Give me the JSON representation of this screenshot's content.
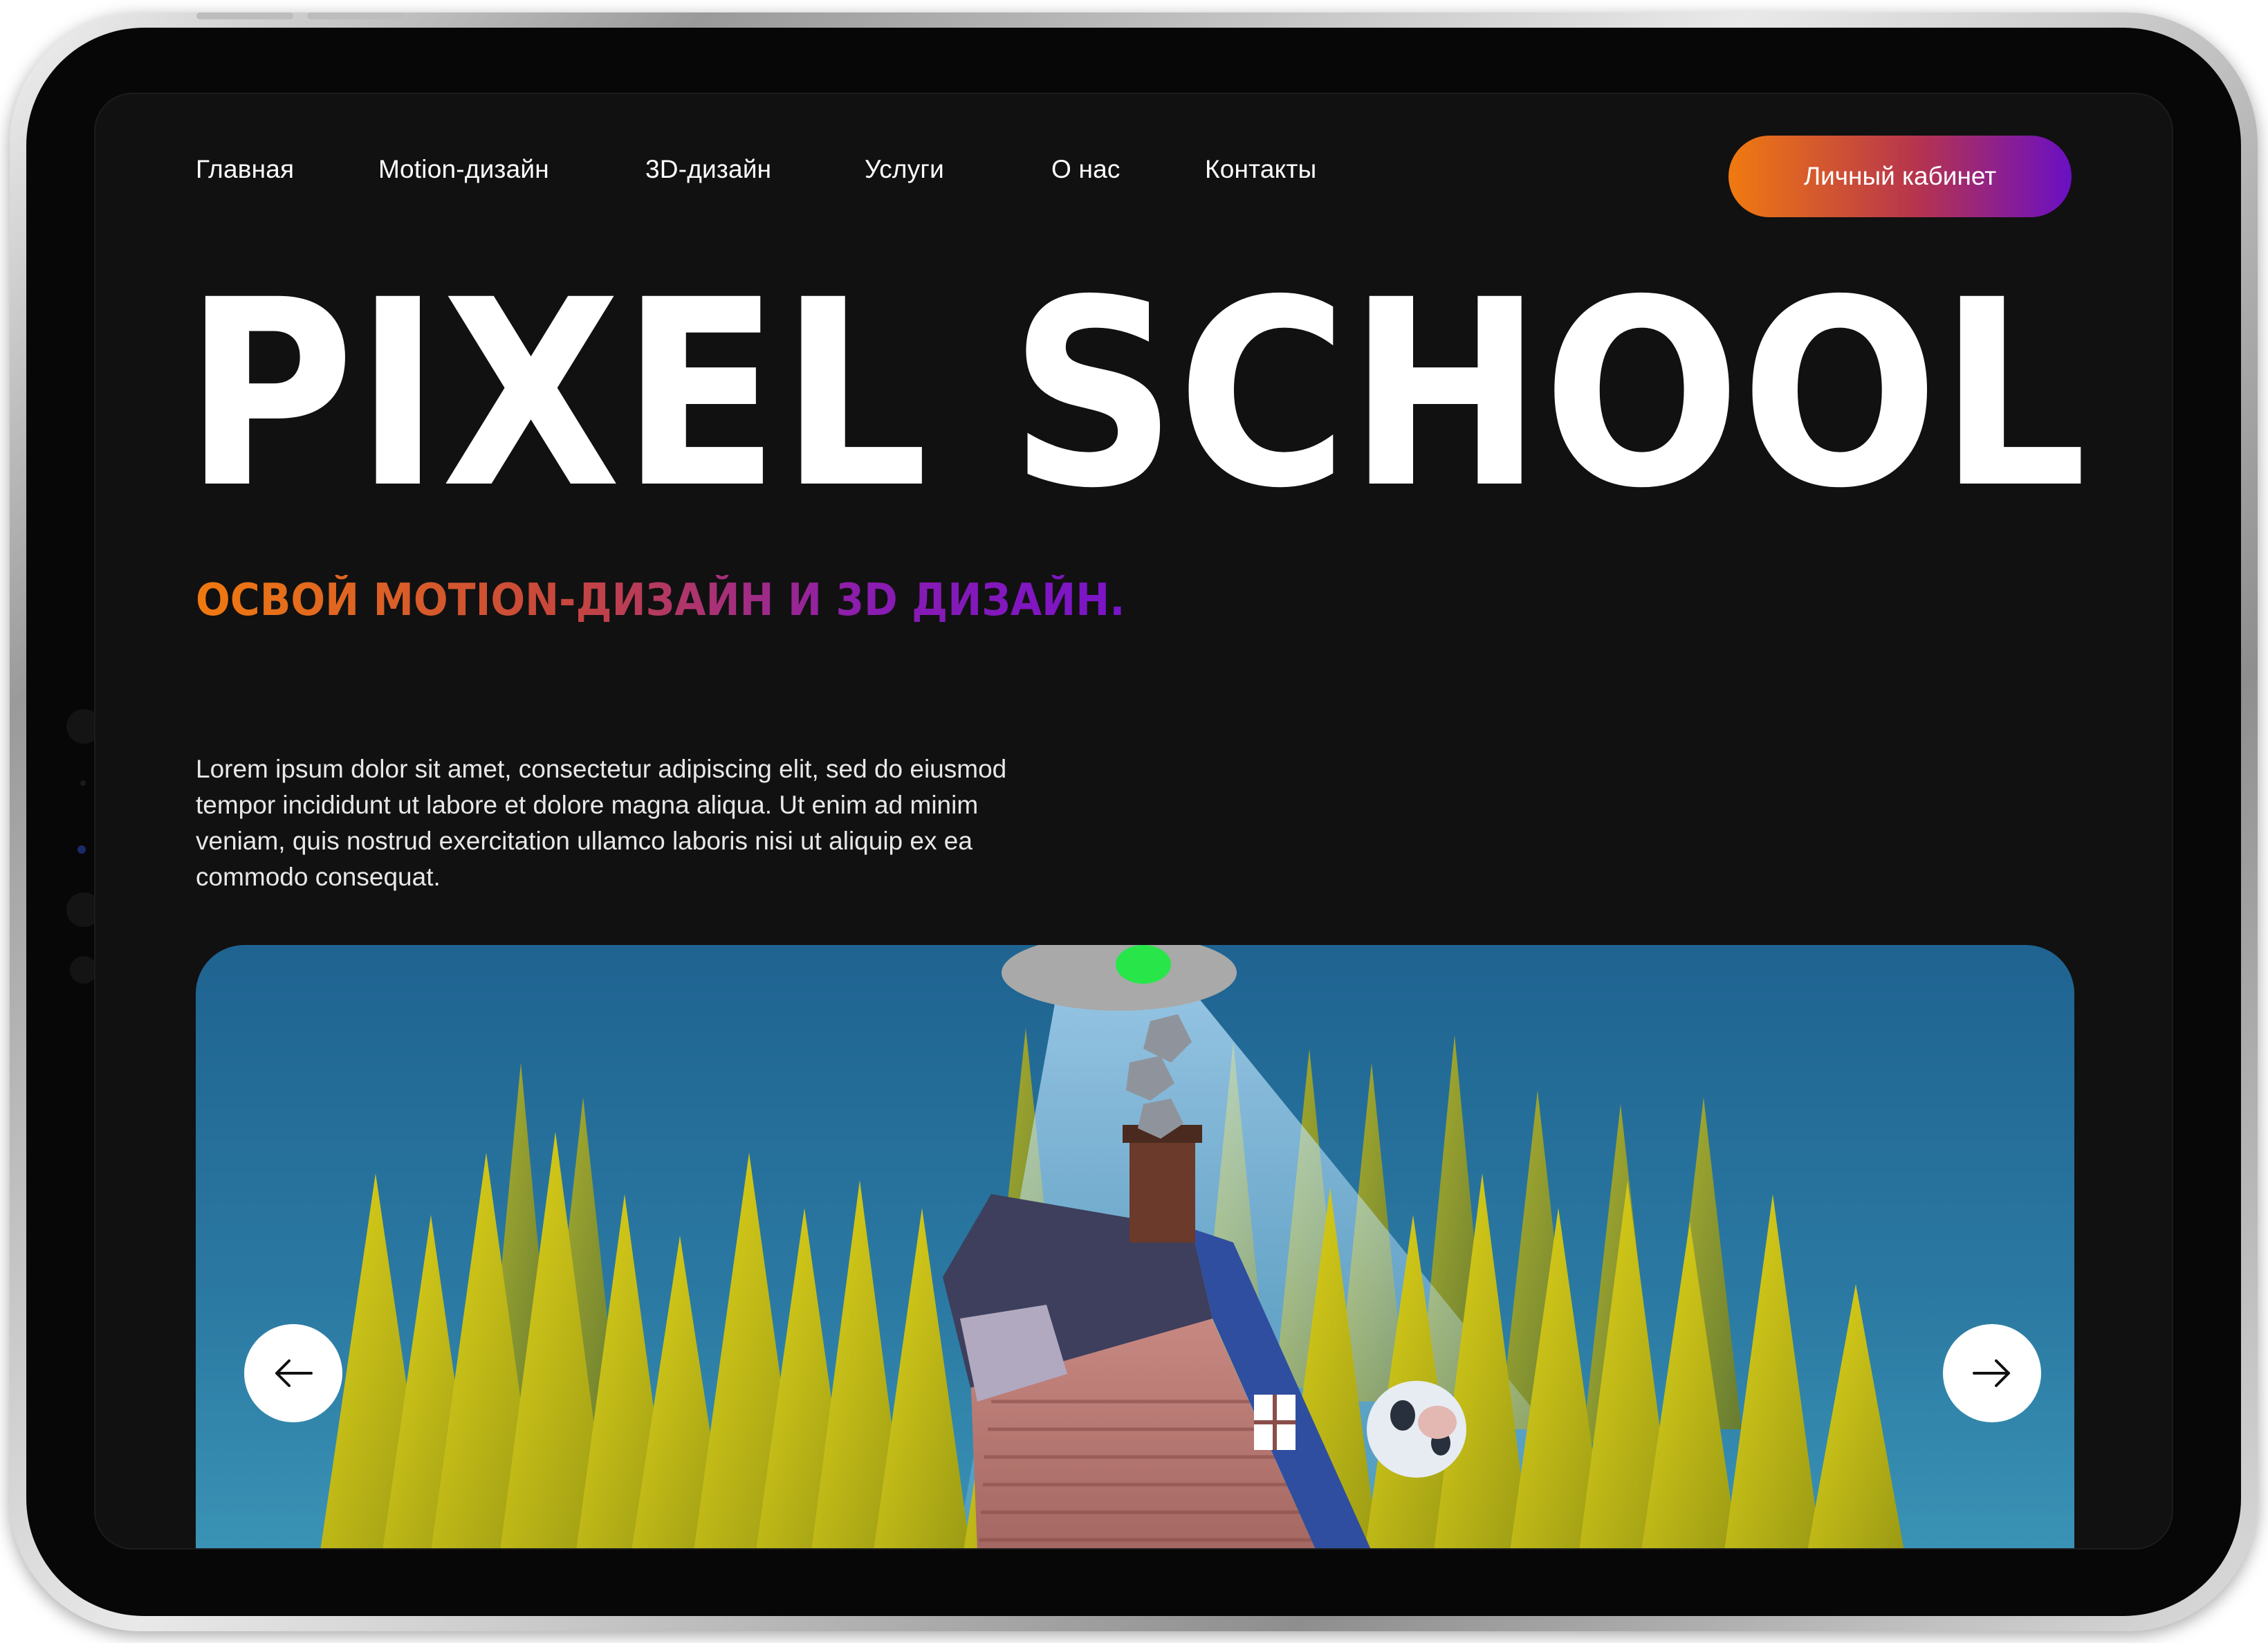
{
  "nav": {
    "links": [
      "Главная",
      "Motion-дизайн",
      "3D-дизайн",
      "Услуги",
      "О нас",
      "Контакты"
    ],
    "cabinet_label": "Личный кабинет"
  },
  "hero": {
    "title": "PIXEL SCHOOL",
    "subtitle": "ОСВОЙ MOTION-ДИЗАЙН И 3D ДИЗАЙН.",
    "text": "Lorem ipsum dolor sit amet, consectetur adipiscing elit, sed do eiusmod tempor incididunt ut labore et dolore magna aliqua. Ut enim ad minim veniam, quis nostrud exercitation ullamco laboris nisi ut aliquip ex ea commodo consequat."
  },
  "slider": {
    "prev_icon": "arrow-left-icon",
    "next_icon": "arrow-right-icon"
  },
  "colors": {
    "background": "#111111",
    "gradient_start": "#f07a10",
    "gradient_end": "#6a0fc4",
    "sky": "#1f6391"
  }
}
